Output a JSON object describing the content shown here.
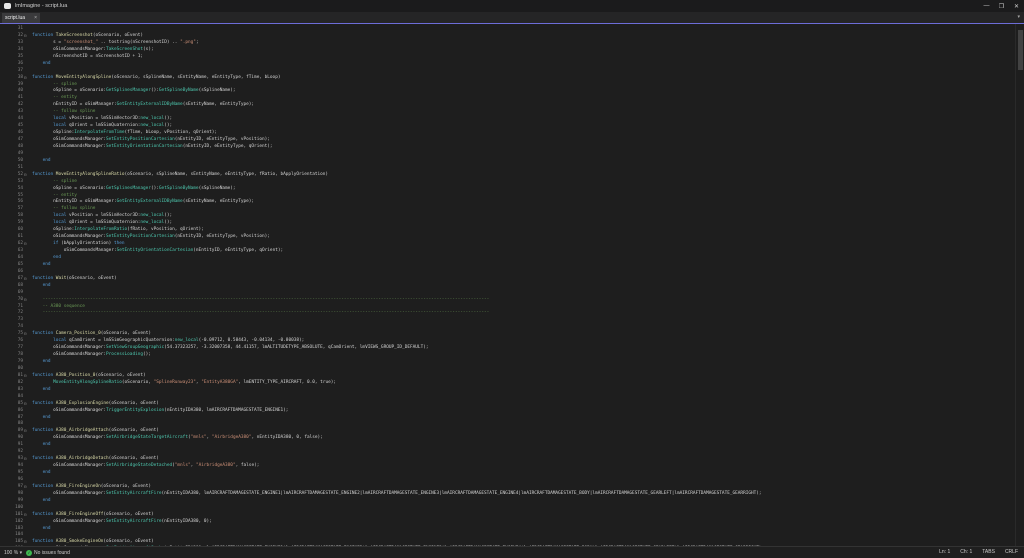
{
  "window": {
    "title": "lmImagine - script.lua",
    "minimize": "—",
    "maximize": "❐",
    "close": "✕"
  },
  "tabs": [
    {
      "label": "script.lua",
      "close": "×"
    }
  ],
  "tab_scroll": "▾",
  "status": {
    "zoom": "100 %",
    "zoom_arrow": "▾",
    "issues": "No issues found",
    "line": "Ln: 1",
    "col": "Ch: 1",
    "indent": "TABS",
    "eol": "CRLF"
  },
  "lines": [
    {
      "n": "31",
      "f": "",
      "t": [
        [
          "tx",
          ""
        ]
      ]
    },
    {
      "n": "32",
      "f": "⊟",
      "t": [
        [
          "kw",
          "function "
        ],
        [
          "fn",
          "TakeScreenshot"
        ],
        [
          "tx",
          "(oScenario, oEvent)"
        ]
      ]
    },
    {
      "n": "33",
      "f": "",
      "t": [
        [
          "tx",
          "        s = "
        ],
        [
          "str",
          "\"screenshot_\""
        ],
        [
          "tx",
          " .. tostring(nScreenshotID) .. "
        ],
        [
          "str",
          "\".png\""
        ],
        [
          "tx",
          ";"
        ]
      ]
    },
    {
      "n": "34",
      "f": "",
      "t": [
        [
          "tx",
          "        oSimCommandsManager:"
        ],
        [
          "mt",
          "TakeScreenShot"
        ],
        [
          "tx",
          "(s);"
        ]
      ]
    },
    {
      "n": "35",
      "f": "",
      "t": [
        [
          "tx",
          "        nScreenshotID = nScreenshotID + 1;"
        ]
      ]
    },
    {
      "n": "36",
      "f": "",
      "t": [
        [
          "kw",
          "    end"
        ]
      ]
    },
    {
      "n": "37",
      "f": "",
      "t": [
        [
          "tx",
          ""
        ]
      ]
    },
    {
      "n": "38",
      "f": "⊟",
      "t": [
        [
          "kw",
          "function "
        ],
        [
          "fn",
          "MoveEntityAlongSpline"
        ],
        [
          "tx",
          "(oScenario, sSplineName, sEntityName, eEntityType, fTime, bLoop)"
        ]
      ]
    },
    {
      "n": "39",
      "f": "",
      "t": [
        [
          "cm",
          "        -- spline"
        ]
      ]
    },
    {
      "n": "40",
      "f": "",
      "t": [
        [
          "tx",
          "        oSpline = oScenario:"
        ],
        [
          "mt",
          "GetSplinesManager"
        ],
        [
          "tx",
          "():"
        ],
        [
          "mt",
          "GetSplineByName"
        ],
        [
          "tx",
          "(sSplineName);"
        ]
      ]
    },
    {
      "n": "41",
      "f": "",
      "t": [
        [
          "cm",
          "        -- entity"
        ]
      ]
    },
    {
      "n": "42",
      "f": "",
      "t": [
        [
          "tx",
          "        nEntityID = oSimManager:"
        ],
        [
          "mt",
          "GetEntityExternalIDByName"
        ],
        [
          "tx",
          "(sEntityName, eEntityType);"
        ]
      ]
    },
    {
      "n": "43",
      "f": "",
      "t": [
        [
          "cm",
          "        -- follow spline"
        ]
      ]
    },
    {
      "n": "44",
      "f": "",
      "t": [
        [
          "kw",
          "        local "
        ],
        [
          "tx",
          "vPosition = lmSSimVector3D:"
        ],
        [
          "mt",
          "new_local"
        ],
        [
          "tx",
          "();"
        ]
      ]
    },
    {
      "n": "45",
      "f": "",
      "t": [
        [
          "kw",
          "        local "
        ],
        [
          "tx",
          "qOrient = lmSSimQuaternion:"
        ],
        [
          "mt",
          "new_local"
        ],
        [
          "tx",
          "();"
        ]
      ]
    },
    {
      "n": "46",
      "f": "",
      "t": [
        [
          "tx",
          "        oSpline:"
        ],
        [
          "mt",
          "InterpolateFromTime"
        ],
        [
          "tx",
          "(fTime, bLoop, vPosition, qOrient);"
        ]
      ]
    },
    {
      "n": "47",
      "f": "",
      "t": [
        [
          "tx",
          "        oSimCommandsManager:"
        ],
        [
          "mt",
          "SetEntityPositionCartesian"
        ],
        [
          "tx",
          "(nEntityID, eEntityType, vPosition);"
        ]
      ]
    },
    {
      "n": "48",
      "f": "",
      "t": [
        [
          "tx",
          "        oSimCommandsManager:"
        ],
        [
          "mt",
          "SetEntityOrientationCartesian"
        ],
        [
          "tx",
          "(nEntityID, eEntityType, qOrient);"
        ]
      ]
    },
    {
      "n": "49",
      "f": "",
      "t": [
        [
          "tx",
          ""
        ]
      ]
    },
    {
      "n": "50",
      "f": "",
      "t": [
        [
          "kw",
          "    end"
        ]
      ]
    },
    {
      "n": "51",
      "f": "",
      "t": [
        [
          "tx",
          ""
        ]
      ]
    },
    {
      "n": "52",
      "f": "⊟",
      "t": [
        [
          "kw",
          "function "
        ],
        [
          "fn",
          "MoveEntityAlongSplineRatio"
        ],
        [
          "tx",
          "(oScenario, sSplineName, sEntityName, eEntityType, fRatio, bApplyOrientation)"
        ]
      ]
    },
    {
      "n": "53",
      "f": "",
      "t": [
        [
          "cm",
          "        -- spline"
        ]
      ]
    },
    {
      "n": "54",
      "f": "",
      "t": [
        [
          "tx",
          "        oSpline = oScenario:"
        ],
        [
          "mt",
          "GetSplinesManager"
        ],
        [
          "tx",
          "():"
        ],
        [
          "mt",
          "GetSplineByName"
        ],
        [
          "tx",
          "(sSplineName);"
        ]
      ]
    },
    {
      "n": "55",
      "f": "",
      "t": [
        [
          "cm",
          "        -- entity"
        ]
      ]
    },
    {
      "n": "56",
      "f": "",
      "t": [
        [
          "tx",
          "        nEntityID = oSimManager:"
        ],
        [
          "mt",
          "GetEntityExternalIDByName"
        ],
        [
          "tx",
          "(sEntityName, eEntityType);"
        ]
      ]
    },
    {
      "n": "57",
      "f": "",
      "t": [
        [
          "cm",
          "        -- follow spline"
        ]
      ]
    },
    {
      "n": "58",
      "f": "",
      "t": [
        [
          "kw",
          "        local "
        ],
        [
          "tx",
          "vPosition = lmSSimVector3D:"
        ],
        [
          "mt",
          "new_local"
        ],
        [
          "tx",
          "();"
        ]
      ]
    },
    {
      "n": "59",
      "f": "",
      "t": [
        [
          "kw",
          "        local "
        ],
        [
          "tx",
          "qOrient = lmSSimQuaternion:"
        ],
        [
          "mt",
          "new_local"
        ],
        [
          "tx",
          "();"
        ]
      ]
    },
    {
      "n": "60",
      "f": "",
      "t": [
        [
          "tx",
          "        oSpline:"
        ],
        [
          "mt",
          "InterpolateFromRatio"
        ],
        [
          "tx",
          "(fRatio, vPosition, qOrient);"
        ]
      ]
    },
    {
      "n": "61",
      "f": "",
      "t": [
        [
          "tx",
          "        oSimCommandsManager:"
        ],
        [
          "mt",
          "SetEntityPositionCartesian"
        ],
        [
          "tx",
          "(nEntityID, eEntityType, vPosition);"
        ]
      ]
    },
    {
      "n": "62",
      "f": "⊟",
      "t": [
        [
          "kw",
          "        if "
        ],
        [
          "tx",
          "(bApplyOrientation) "
        ],
        [
          "kw",
          "then"
        ]
      ]
    },
    {
      "n": "63",
      "f": "",
      "t": [
        [
          "tx",
          "            oSimCommandsManager:"
        ],
        [
          "mt",
          "SetEntityOrientationCartesian"
        ],
        [
          "tx",
          "(nEntityID, eEntityType, qOrient);"
        ]
      ]
    },
    {
      "n": "64",
      "f": "",
      "t": [
        [
          "kw",
          "        end"
        ]
      ]
    },
    {
      "n": "65",
      "f": "",
      "t": [
        [
          "kw",
          "    end"
        ]
      ]
    },
    {
      "n": "66",
      "f": "",
      "t": [
        [
          "tx",
          ""
        ]
      ]
    },
    {
      "n": "67",
      "f": "⊟",
      "t": [
        [
          "kw",
          "function "
        ],
        [
          "fn",
          "Wait"
        ],
        [
          "tx",
          "(oScenario, oEvent)"
        ]
      ]
    },
    {
      "n": "68",
      "f": "",
      "t": [
        [
          "kw",
          "    end"
        ]
      ]
    },
    {
      "n": "69",
      "f": "",
      "t": [
        [
          "tx",
          ""
        ]
      ]
    },
    {
      "n": "70",
      "f": "⊟",
      "t": [
        [
          "cm",
          "    -------------------------------------------------------------------------------------------------------------------------------------------------------------------------"
        ]
      ]
    },
    {
      "n": "71",
      "f": "",
      "t": [
        [
          "cm",
          "    -- A380 sequence"
        ]
      ]
    },
    {
      "n": "72",
      "f": "",
      "t": [
        [
          "cm",
          "    -------------------------------------------------------------------------------------------------------------------------------------------------------------------------"
        ]
      ]
    },
    {
      "n": "73",
      "f": "",
      "t": [
        [
          "tx",
          ""
        ]
      ]
    },
    {
      "n": "74",
      "f": "",
      "t": [
        [
          "tx",
          ""
        ]
      ]
    },
    {
      "n": "75",
      "f": "⊟",
      "t": [
        [
          "kw",
          "function "
        ],
        [
          "fn",
          "Camera_Position_0"
        ],
        [
          "tx",
          "(oScenario, oEvent)"
        ]
      ]
    },
    {
      "n": "76",
      "f": "",
      "t": [
        [
          "kw",
          "        local "
        ],
        [
          "tx",
          "qCamOrient = lmSSimGeographicQuaternion:"
        ],
        [
          "mt",
          "new_local"
        ],
        [
          "tx",
          "(-0.09712, 0.58443, -0.04134, -0.80038);"
        ]
      ]
    },
    {
      "n": "77",
      "f": "",
      "t": [
        [
          "tx",
          "        oSimCommandsManager:"
        ],
        [
          "mt",
          "SetViewGroupGeographic"
        ],
        [
          "tx",
          "(54.37323257, -3.32007358, 44.41157, lmALTITUDETYPE_ABSOLUTE, qCamOrient, lmVIEWS_GROUP_ID_DEFAULT);"
        ]
      ]
    },
    {
      "n": "78",
      "f": "",
      "t": [
        [
          "tx",
          "        oSimCommandsManager:"
        ],
        [
          "mt",
          "ProcessLoading"
        ],
        [
          "tx",
          "();"
        ]
      ]
    },
    {
      "n": "79",
      "f": "",
      "t": [
        [
          "kw",
          "    end"
        ]
      ]
    },
    {
      "n": "80",
      "f": "",
      "t": [
        [
          "tx",
          ""
        ]
      ]
    },
    {
      "n": "81",
      "f": "⊟",
      "t": [
        [
          "kw",
          "function "
        ],
        [
          "fn",
          "A380_Position_0"
        ],
        [
          "tx",
          "(oScenario, oEvent)"
        ]
      ]
    },
    {
      "n": "82",
      "f": "",
      "t": [
        [
          "tx",
          "        "
        ],
        [
          "mt",
          "MoveEntityAlongSplineRatio"
        ],
        [
          "tx",
          "(oScenario, "
        ],
        [
          "str",
          "\"SplineRunway23\""
        ],
        [
          "tx",
          ", "
        ],
        [
          "str",
          "\"EntityA380GA\""
        ],
        [
          "tx",
          ", lmENTITY_TYPE_AIRCRAFT, 0.0, true);"
        ]
      ]
    },
    {
      "n": "83",
      "f": "",
      "t": [
        [
          "kw",
          "    end"
        ]
      ]
    },
    {
      "n": "84",
      "f": "",
      "t": [
        [
          "tx",
          ""
        ]
      ]
    },
    {
      "n": "85",
      "f": "⊟",
      "t": [
        [
          "kw",
          "function "
        ],
        [
          "fn",
          "A380_ExplosionEngine"
        ],
        [
          "tx",
          "(oScenario, oEvent)"
        ]
      ]
    },
    {
      "n": "86",
      "f": "",
      "t": [
        [
          "tx",
          "        oSimCommandsManager:"
        ],
        [
          "mt",
          "TriggerEntityExplosion"
        ],
        [
          "tx",
          "(nEntityIDA380, lmAIRCRAFTDAMAGESTATE_ENGINE1);"
        ]
      ]
    },
    {
      "n": "87",
      "f": "",
      "t": [
        [
          "kw",
          "    end"
        ]
      ]
    },
    {
      "n": "88",
      "f": "",
      "t": [
        [
          "tx",
          ""
        ]
      ]
    },
    {
      "n": "89",
      "f": "⊟",
      "t": [
        [
          "kw",
          "function "
        ],
        [
          "fn",
          "A380_AirbridgeAttach"
        ],
        [
          "tx",
          "(oScenario, oEvent)"
        ]
      ]
    },
    {
      "n": "90",
      "f": "",
      "t": [
        [
          "tx",
          "        oSimCommandsManager:"
        ],
        [
          "mt",
          "SetAirbridgeStateTargetAircraft"
        ],
        [
          "tx",
          "("
        ],
        [
          "str",
          "\"mnls\""
        ],
        [
          "tx",
          ", "
        ],
        [
          "str",
          "\"AirbridgeA380\""
        ],
        [
          "tx",
          ", nEntityIDA380, 0, false);"
        ]
      ]
    },
    {
      "n": "91",
      "f": "",
      "t": [
        [
          "kw",
          "    end"
        ]
      ]
    },
    {
      "n": "92",
      "f": "",
      "t": [
        [
          "tx",
          ""
        ]
      ]
    },
    {
      "n": "93",
      "f": "⊟",
      "t": [
        [
          "kw",
          "function "
        ],
        [
          "fn",
          "A380_AirbridgeDetach"
        ],
        [
          "tx",
          "(oScenario, oEvent)"
        ]
      ]
    },
    {
      "n": "94",
      "f": "",
      "t": [
        [
          "tx",
          "        oSimCommandsManager:"
        ],
        [
          "mt",
          "SetAirbridgeStateDetached"
        ],
        [
          "tx",
          "("
        ],
        [
          "str",
          "\"mnls\""
        ],
        [
          "tx",
          ", "
        ],
        [
          "str",
          "\"AirbridgeA380\""
        ],
        [
          "tx",
          ", false);"
        ]
      ]
    },
    {
      "n": "95",
      "f": "",
      "t": [
        [
          "kw",
          "    end"
        ]
      ]
    },
    {
      "n": "96",
      "f": "",
      "t": [
        [
          "tx",
          ""
        ]
      ]
    },
    {
      "n": "97",
      "f": "⊟",
      "t": [
        [
          "kw",
          "function "
        ],
        [
          "fn",
          "A380_FireEngineOn"
        ],
        [
          "tx",
          "(oScenario, oEvent)"
        ]
      ]
    },
    {
      "n": "98",
      "f": "",
      "t": [
        [
          "tx",
          "        oSimCommandsManager:"
        ],
        [
          "mt",
          "SetEntityAircraftFire"
        ],
        [
          "tx",
          "(nEntityIDA380, lmAIRCRAFTDAMAGESTATE_ENGINE1|lmAIRCRAFTDAMAGESTATE_ENGINE2|lmAIRCRAFTDAMAGESTATE_ENGINE3|lmAIRCRAFTDAMAGESTATE_ENGINE4|lmAIRCRAFTDAMAGESTATE_BODY|lmAIRCRAFTDAMAGESTATE_GEARLEFT|lmAIRCRAFTDAMAGESTATE_GEARRIGHT);"
        ]
      ]
    },
    {
      "n": "99",
      "f": "",
      "t": [
        [
          "kw",
          "    end"
        ]
      ]
    },
    {
      "n": "100",
      "f": "",
      "t": [
        [
          "tx",
          ""
        ]
      ]
    },
    {
      "n": "101",
      "f": "⊟",
      "t": [
        [
          "kw",
          "function "
        ],
        [
          "fn",
          "A380_FireEngineOff"
        ],
        [
          "tx",
          "(oScenario, oEvent)"
        ]
      ]
    },
    {
      "n": "102",
      "f": "",
      "t": [
        [
          "tx",
          "        oSimCommandsManager:"
        ],
        [
          "mt",
          "SetEntityAircraftFire"
        ],
        [
          "tx",
          "(nEntityIDA380, 0);"
        ]
      ]
    },
    {
      "n": "103",
      "f": "",
      "t": [
        [
          "kw",
          "    end"
        ]
      ]
    },
    {
      "n": "104",
      "f": "",
      "t": [
        [
          "tx",
          ""
        ]
      ]
    },
    {
      "n": "105",
      "f": "⊟",
      "t": [
        [
          "kw",
          "function "
        ],
        [
          "fn",
          "A380_SmokeEngineOn"
        ],
        [
          "tx",
          "(oScenario, oEvent)"
        ]
      ]
    },
    {
      "n": "106",
      "f": "",
      "t": [
        [
          "tx",
          "        oSimCommandsManager:"
        ],
        [
          "mt",
          "SetEntityAircraftSmoke"
        ],
        [
          "tx",
          "(nEntityIDA380, lmAIRCRAFTDAMAGESTATE_ENGINE1|lmAIRCRAFTDAMAGESTATE_ENGINE2|lmAIRCRAFTDAMAGESTATE_ENGINE3|lmAIRCRAFTDAMAGESTATE_ENGINE4|lmAIRCRAFTDAMAGESTATE_BODY|lmAIRCRAFTDAMAGESTATE_GEARLEFT|lmAIRCRAFTDAMAGESTATE_GEARRIGHT);"
        ]
      ]
    }
  ]
}
